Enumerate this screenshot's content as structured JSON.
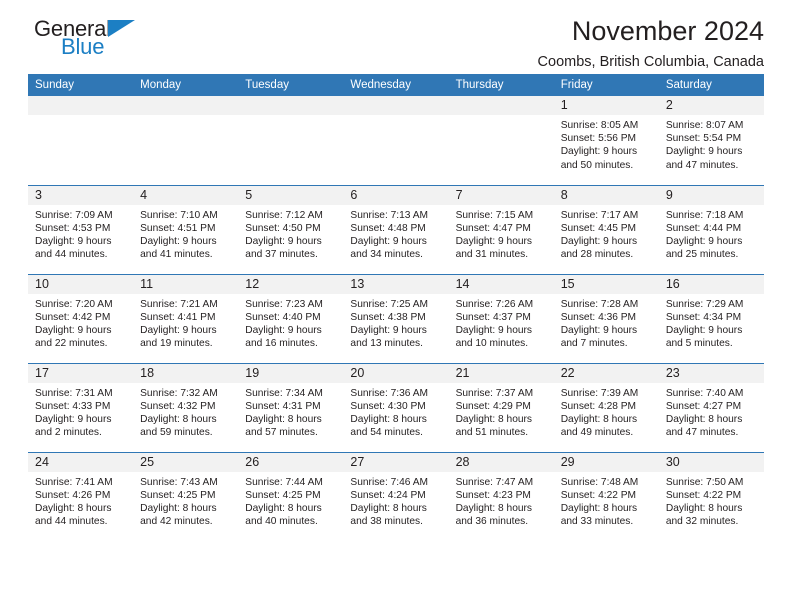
{
  "brand": {
    "name_dark": "General",
    "name_blue": "Blue",
    "triangle_icon": "blue-triangle-logo-mark"
  },
  "header": {
    "title": "November 2024",
    "subtitle": "Coombs, British Columbia, Canada"
  },
  "colors": {
    "header_blue": "#3077b5",
    "daynum_band": "#f2f2f2",
    "brand_blue": "#1c7fc4",
    "text": "#231f20"
  },
  "weekday_headers": [
    "Sunday",
    "Monday",
    "Tuesday",
    "Wednesday",
    "Thursday",
    "Friday",
    "Saturday"
  ],
  "weeks": [
    [
      {
        "day": "",
        "lines": []
      },
      {
        "day": "",
        "lines": []
      },
      {
        "day": "",
        "lines": []
      },
      {
        "day": "",
        "lines": []
      },
      {
        "day": "",
        "lines": []
      },
      {
        "day": "1",
        "lines": [
          "Sunrise: 8:05 AM",
          "Sunset: 5:56 PM",
          "Daylight: 9 hours",
          "and 50 minutes."
        ]
      },
      {
        "day": "2",
        "lines": [
          "Sunrise: 8:07 AM",
          "Sunset: 5:54 PM",
          "Daylight: 9 hours",
          "and 47 minutes."
        ]
      }
    ],
    [
      {
        "day": "3",
        "lines": [
          "Sunrise: 7:09 AM",
          "Sunset: 4:53 PM",
          "Daylight: 9 hours",
          "and 44 minutes."
        ]
      },
      {
        "day": "4",
        "lines": [
          "Sunrise: 7:10 AM",
          "Sunset: 4:51 PM",
          "Daylight: 9 hours",
          "and 41 minutes."
        ]
      },
      {
        "day": "5",
        "lines": [
          "Sunrise: 7:12 AM",
          "Sunset: 4:50 PM",
          "Daylight: 9 hours",
          "and 37 minutes."
        ]
      },
      {
        "day": "6",
        "lines": [
          "Sunrise: 7:13 AM",
          "Sunset: 4:48 PM",
          "Daylight: 9 hours",
          "and 34 minutes."
        ]
      },
      {
        "day": "7",
        "lines": [
          "Sunrise: 7:15 AM",
          "Sunset: 4:47 PM",
          "Daylight: 9 hours",
          "and 31 minutes."
        ]
      },
      {
        "day": "8",
        "lines": [
          "Sunrise: 7:17 AM",
          "Sunset: 4:45 PM",
          "Daylight: 9 hours",
          "and 28 minutes."
        ]
      },
      {
        "day": "9",
        "lines": [
          "Sunrise: 7:18 AM",
          "Sunset: 4:44 PM",
          "Daylight: 9 hours",
          "and 25 minutes."
        ]
      }
    ],
    [
      {
        "day": "10",
        "lines": [
          "Sunrise: 7:20 AM",
          "Sunset: 4:42 PM",
          "Daylight: 9 hours",
          "and 22 minutes."
        ]
      },
      {
        "day": "11",
        "lines": [
          "Sunrise: 7:21 AM",
          "Sunset: 4:41 PM",
          "Daylight: 9 hours",
          "and 19 minutes."
        ]
      },
      {
        "day": "12",
        "lines": [
          "Sunrise: 7:23 AM",
          "Sunset: 4:40 PM",
          "Daylight: 9 hours",
          "and 16 minutes."
        ]
      },
      {
        "day": "13",
        "lines": [
          "Sunrise: 7:25 AM",
          "Sunset: 4:38 PM",
          "Daylight: 9 hours",
          "and 13 minutes."
        ]
      },
      {
        "day": "14",
        "lines": [
          "Sunrise: 7:26 AM",
          "Sunset: 4:37 PM",
          "Daylight: 9 hours",
          "and 10 minutes."
        ]
      },
      {
        "day": "15",
        "lines": [
          "Sunrise: 7:28 AM",
          "Sunset: 4:36 PM",
          "Daylight: 9 hours",
          "and 7 minutes."
        ]
      },
      {
        "day": "16",
        "lines": [
          "Sunrise: 7:29 AM",
          "Sunset: 4:34 PM",
          "Daylight: 9 hours",
          "and 5 minutes."
        ]
      }
    ],
    [
      {
        "day": "17",
        "lines": [
          "Sunrise: 7:31 AM",
          "Sunset: 4:33 PM",
          "Daylight: 9 hours",
          "and 2 minutes."
        ]
      },
      {
        "day": "18",
        "lines": [
          "Sunrise: 7:32 AM",
          "Sunset: 4:32 PM",
          "Daylight: 8 hours",
          "and 59 minutes."
        ]
      },
      {
        "day": "19",
        "lines": [
          "Sunrise: 7:34 AM",
          "Sunset: 4:31 PM",
          "Daylight: 8 hours",
          "and 57 minutes."
        ]
      },
      {
        "day": "20",
        "lines": [
          "Sunrise: 7:36 AM",
          "Sunset: 4:30 PM",
          "Daylight: 8 hours",
          "and 54 minutes."
        ]
      },
      {
        "day": "21",
        "lines": [
          "Sunrise: 7:37 AM",
          "Sunset: 4:29 PM",
          "Daylight: 8 hours",
          "and 51 minutes."
        ]
      },
      {
        "day": "22",
        "lines": [
          "Sunrise: 7:39 AM",
          "Sunset: 4:28 PM",
          "Daylight: 8 hours",
          "and 49 minutes."
        ]
      },
      {
        "day": "23",
        "lines": [
          "Sunrise: 7:40 AM",
          "Sunset: 4:27 PM",
          "Daylight: 8 hours",
          "and 47 minutes."
        ]
      }
    ],
    [
      {
        "day": "24",
        "lines": [
          "Sunrise: 7:41 AM",
          "Sunset: 4:26 PM",
          "Daylight: 8 hours",
          "and 44 minutes."
        ]
      },
      {
        "day": "25",
        "lines": [
          "Sunrise: 7:43 AM",
          "Sunset: 4:25 PM",
          "Daylight: 8 hours",
          "and 42 minutes."
        ]
      },
      {
        "day": "26",
        "lines": [
          "Sunrise: 7:44 AM",
          "Sunset: 4:25 PM",
          "Daylight: 8 hours",
          "and 40 minutes."
        ]
      },
      {
        "day": "27",
        "lines": [
          "Sunrise: 7:46 AM",
          "Sunset: 4:24 PM",
          "Daylight: 8 hours",
          "and 38 minutes."
        ]
      },
      {
        "day": "28",
        "lines": [
          "Sunrise: 7:47 AM",
          "Sunset: 4:23 PM",
          "Daylight: 8 hours",
          "and 36 minutes."
        ]
      },
      {
        "day": "29",
        "lines": [
          "Sunrise: 7:48 AM",
          "Sunset: 4:22 PM",
          "Daylight: 8 hours",
          "and 33 minutes."
        ]
      },
      {
        "day": "30",
        "lines": [
          "Sunrise: 7:50 AM",
          "Sunset: 4:22 PM",
          "Daylight: 8 hours",
          "and 32 minutes."
        ]
      }
    ]
  ]
}
